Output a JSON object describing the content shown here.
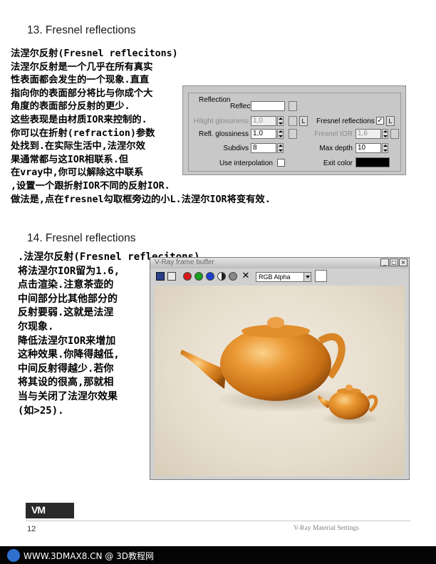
{
  "section13": {
    "heading": "13. Fresnel reflections",
    "text": "法涅尔反射(Fresnel reflecitons)\n法涅尔反射是一个几乎在所有真实\n性表面都会发生的一个现象.直直\n指向你的表面部分将比与你成个大\n角度的表面部分反射的更少.\n这些表现是由材质IOR来控制的.\n你可以在折射(refraction)参数\n处找到.在实际生活中,法涅尔效\n果通常都与这IOR相联系.但\n在vray中,你可以解除这中联系\n,设置一个跟折射IOR不同的反射IOR.\n做法是,点在fresnel勾取框旁边的小L.法涅尔IOR将变有效."
  },
  "reflection_panel": {
    "group_label": "Reflection",
    "reflect_label": "Reflect",
    "reflect_color": "#ffffff",
    "hilight_glossiness_label": "Hilight glossiness",
    "hilight_glossiness_value": "1,0",
    "refl_glossiness_label": "Refl. glossiness",
    "refl_glossiness_value": "1,0",
    "subdivs_label": "Subdivs",
    "subdivs_value": "8",
    "use_interpolation_label": "Use interpolation",
    "fresnel_reflections_label": "Fresnel reflections",
    "fresnel_checked": "✓",
    "fresnel_ior_label": "Fresnel IOR",
    "fresnel_ior_value": "1,6",
    "max_depth_label": "Max depth",
    "max_depth_value": "10",
    "exit_color_label": "Exit color",
    "exit_color": "#000000",
    "lock_label": "L"
  },
  "section14": {
    "heading": "14. Fresnel reflections",
    "text": ".法涅尔反射(Fresnel reflecitons)\n将法涅尔IOR留为1.6,\n点击渲染.注意茶壶的\n中间部分比其他部分的\n反射要弱.这就是法涅\n尔现象.\n降低法涅尔IOR来增加\n这种效果.你降得越低,\n中间反射得越少.若你\n将其设的很高,那就相\n当与关闭了法涅尔效果\n(如>25)."
  },
  "frame_buffer": {
    "title": "V-Ray frame buffer",
    "channel": "RGB Alpha",
    "minimize": "_",
    "maximize": "□",
    "close": "×",
    "render_bg": "#ebe3d5",
    "teapot_color": "#e8902a"
  },
  "footer": {
    "logo": "VM",
    "page_number": "12",
    "title": "V-Ray Material Settings"
  },
  "watermark": {
    "text": "WWW.3DMAX8.CN @ 3D教程网"
  }
}
